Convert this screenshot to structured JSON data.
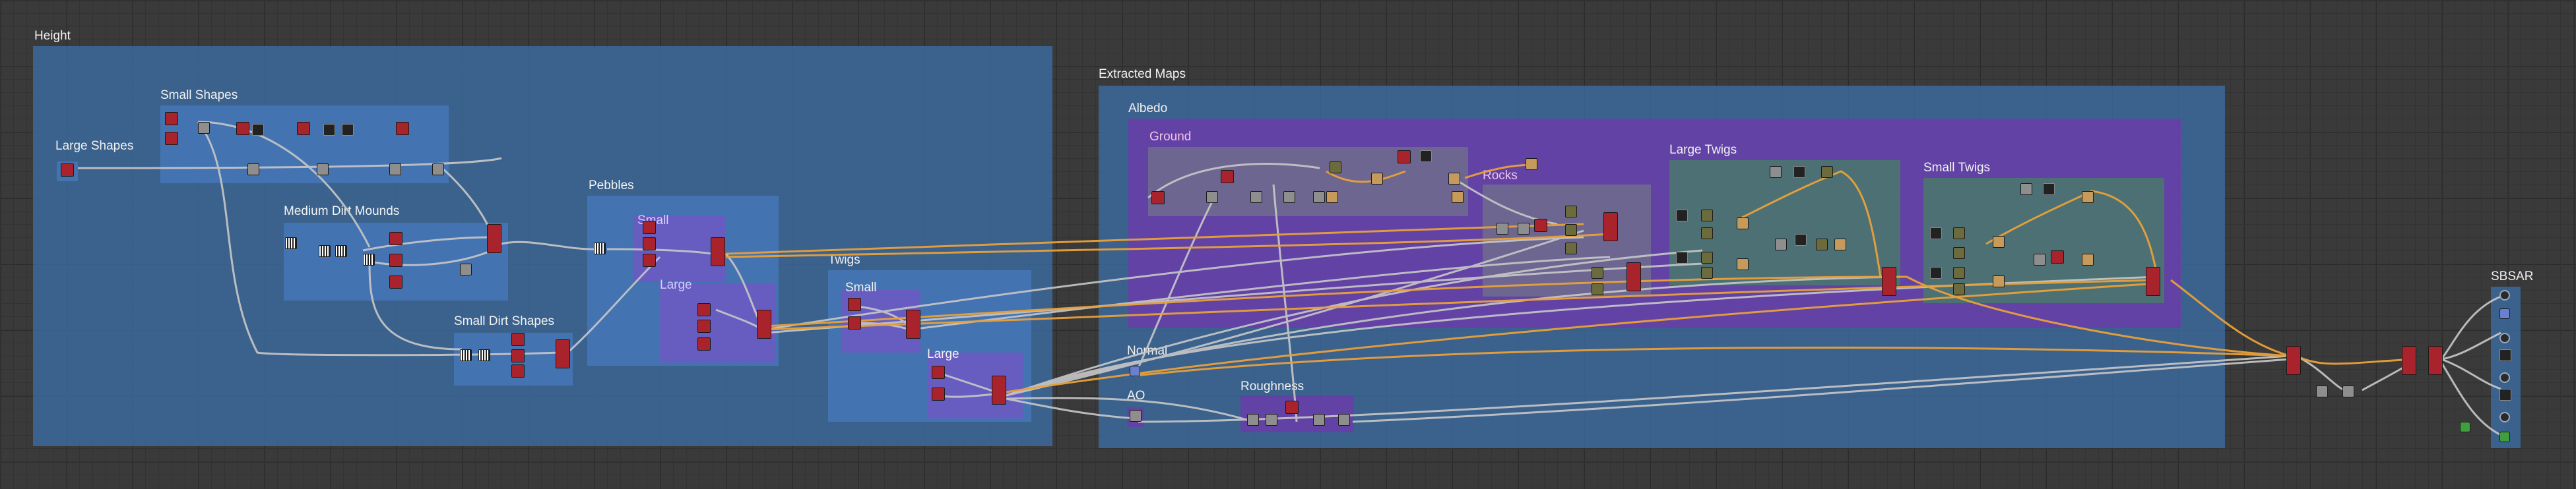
{
  "frames": {
    "height": "Height",
    "small_shapes": "Small Shapes",
    "large_shapes": "Large Shapes",
    "medium_dirt_mounds": "Medium Dirt Mounds",
    "small_dirt_shapes": "Small Dirt Shapes",
    "pebbles": "Pebbles",
    "pebbles_small": "Small",
    "pebbles_large": "Large",
    "twigs": "Twigs",
    "twigs_small": "Small",
    "twigs_large": "Large",
    "extracted_maps": "Extracted Maps",
    "albedo": "Albedo",
    "ground": "Ground",
    "rocks": "Rocks",
    "large_twigs": "Large Twigs",
    "small_twigs": "Small Twigs",
    "normal": "Normal",
    "ao": "AO",
    "roughness": "Roughness",
    "sbsar": "SBSAR"
  },
  "colors": {
    "wire_default": "#c8c8c8",
    "wire_orange": "#e8a13a",
    "frame_blue": "#3c6ea5",
    "frame_violet": "#683ea8",
    "frame_teal": "#4a766e"
  }
}
